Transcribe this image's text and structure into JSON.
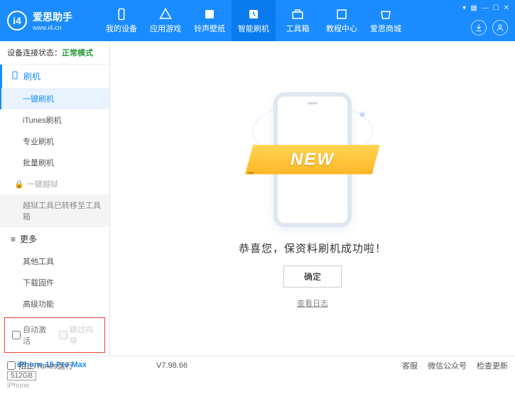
{
  "header": {
    "appName": "爱思助手",
    "appUrl": "www.i4.cn",
    "nav": [
      {
        "label": "我的设备"
      },
      {
        "label": "应用游戏"
      },
      {
        "label": "铃声壁纸"
      },
      {
        "label": "智能刷机"
      },
      {
        "label": "工具箱"
      },
      {
        "label": "教程中心"
      },
      {
        "label": "爱思商城"
      }
    ]
  },
  "sidebar": {
    "statusLabel": "设备连接状态：",
    "statusMode": "正常模式",
    "flashHeader": "刷机",
    "items": {
      "oneKeyFlash": "一键刷机",
      "itunesFlash": "iTunes刷机",
      "proFlash": "专业刷机",
      "batchFlash": "批量刷机",
      "jailbreak": "一键越狱",
      "jailbreakMoved": "越狱工具已转移至工具箱"
    },
    "moreHeader": "更多",
    "more": {
      "otherTools": "其他工具",
      "downloadFw": "下载固件",
      "advanced": "高级功能"
    },
    "checkboxes": {
      "autoActivate": "自动激活",
      "skipGuide": "跳过向导"
    },
    "device": {
      "name": "iPhone 15 Pro Max",
      "storage": "512GB",
      "type": "iPhone"
    }
  },
  "main": {
    "ribbon": "NEW",
    "successText": "恭喜您，保资料刷机成功啦！",
    "okButton": "确定",
    "viewLog": "查看日志"
  },
  "footer": {
    "blockItunes": "阻止iTunes运行",
    "version": "V7.98.66",
    "links": {
      "support": "客服",
      "wechat": "微信公众号",
      "checkUpdate": "检查更新"
    }
  }
}
